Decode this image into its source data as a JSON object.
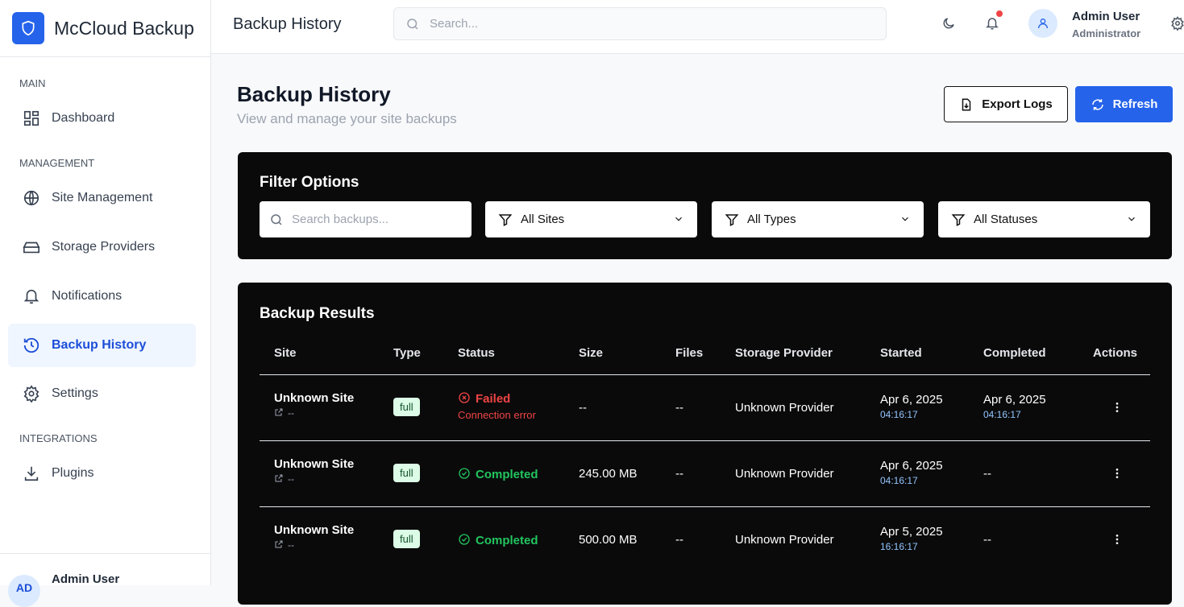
{
  "app": {
    "name": "McCloud Backup"
  },
  "sidebar": {
    "sections": [
      "MAIN",
      "MANAGEMENT",
      "INTEGRATIONS"
    ],
    "items": [
      {
        "label": "Dashboard",
        "icon": "dashboard-icon"
      },
      {
        "label": "Site Management",
        "icon": "globe-icon"
      },
      {
        "label": "Storage Providers",
        "icon": "hard-drive-icon"
      },
      {
        "label": "Notifications",
        "icon": "bell-icon"
      },
      {
        "label": "Backup History",
        "icon": "history-icon",
        "active": true
      },
      {
        "label": "Settings",
        "icon": "gear-icon"
      },
      {
        "label": "Plugins",
        "icon": "download-icon"
      }
    ],
    "footer": {
      "initials": "AD",
      "name": "Admin User"
    }
  },
  "header": {
    "title": "Backup History",
    "search_placeholder": "Search...",
    "user": {
      "name": "Admin User",
      "role": "Administrator"
    }
  },
  "page": {
    "title": "Backup History",
    "subtitle": "View and manage your site backups",
    "export_label": "Export Logs",
    "refresh_label": "Refresh"
  },
  "filters": {
    "title": "Filter Options",
    "search_placeholder": "Search backups...",
    "site": "All Sites",
    "type": "All Types",
    "status": "All Statuses"
  },
  "results": {
    "title": "Backup Results",
    "columns": [
      "Site",
      "Type",
      "Status",
      "Size",
      "Files",
      "Storage Provider",
      "Started",
      "Completed",
      "Actions"
    ],
    "rows": [
      {
        "site": "Unknown Site",
        "url": "--",
        "type": "full",
        "status": "Failed",
        "error": "Connection error",
        "size": "--",
        "files": "--",
        "provider": "Unknown Provider",
        "started_date": "Apr 6, 2025",
        "started_time": "04:16:17",
        "completed_date": "Apr 6, 2025",
        "completed_time": "04:16:17"
      },
      {
        "site": "Unknown Site",
        "url": "--",
        "type": "full",
        "status": "Completed",
        "error": "",
        "size": "245.00 MB",
        "files": "--",
        "provider": "Unknown Provider",
        "started_date": "Apr 6, 2025",
        "started_time": "04:16:17",
        "completed_date": "--",
        "completed_time": ""
      },
      {
        "site": "Unknown Site",
        "url": "--",
        "type": "full",
        "status": "Completed",
        "error": "",
        "size": "500.00 MB",
        "files": "--",
        "provider": "Unknown Provider",
        "started_date": "Apr 5, 2025",
        "started_time": "16:16:17",
        "completed_date": "--",
        "completed_time": ""
      }
    ]
  },
  "colors": {
    "accent": "#2563eb",
    "failed": "#ef4444",
    "completed": "#22c55e"
  }
}
